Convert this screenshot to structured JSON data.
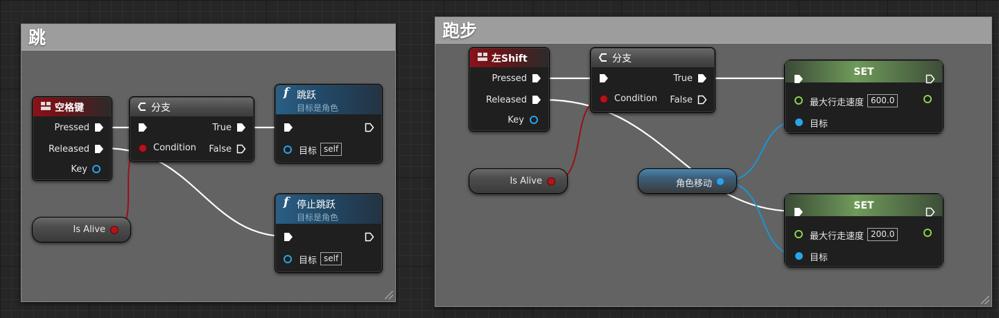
{
  "comments": [
    {
      "title": "跳"
    },
    {
      "title": "跑步"
    }
  ],
  "jump": {
    "key_node": {
      "title": "空格键",
      "pins": {
        "pressed": "Pressed",
        "released": "Released",
        "key": "Key"
      }
    },
    "branch": {
      "title": "分支",
      "condition": "Condition",
      "true": "True",
      "false": "False"
    },
    "jump_fn": {
      "title": "跳跃",
      "subtitle": "目标是角色",
      "target_label": "目标",
      "target_value": "self"
    },
    "stop_jump_fn": {
      "title": "停止跳跃",
      "subtitle": "目标是角色",
      "target_label": "目标",
      "target_value": "self"
    },
    "is_alive": {
      "label": "Is Alive"
    }
  },
  "run": {
    "key_node": {
      "title": "左Shift",
      "pins": {
        "pressed": "Pressed",
        "released": "Released",
        "key": "Key"
      }
    },
    "branch": {
      "title": "分支",
      "condition": "Condition",
      "true": "True",
      "false": "False"
    },
    "is_alive": {
      "label": "Is Alive"
    },
    "char_move": {
      "label": "角色移动"
    },
    "set_nodes": [
      {
        "title": "SET",
        "speed_label": "最大行走速度",
        "speed_value": "600.0",
        "target_label": "目标"
      },
      {
        "title": "SET",
        "speed_label": "最大行走速度",
        "speed_value": "200.0",
        "target_label": "目标"
      }
    ]
  },
  "colors": {
    "exec_wire": "#ffffff",
    "bool_wire": "#9a1017",
    "object_wire": "#1a95d6",
    "float_pin": "#8fd34a",
    "key_header": "#8c1219",
    "function_header": "#2b5f86",
    "set_header": "#6f9a5a"
  },
  "icons": {
    "key_icon": "keyboard-icon",
    "branch_icon": "branch-icon",
    "function_icon": "function-icon"
  }
}
